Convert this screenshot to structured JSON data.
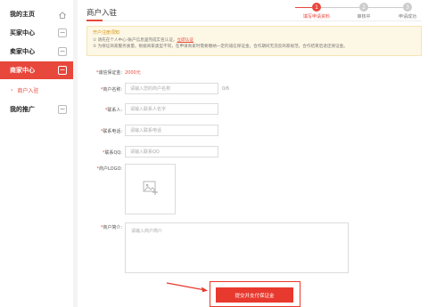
{
  "sidebar": {
    "items": [
      {
        "label": "我的主页",
        "icon": "home-icon"
      },
      {
        "label": "买家中心",
        "icon": "collapse-minus-icon"
      },
      {
        "label": "卖家中心",
        "icon": "collapse-minus-icon"
      },
      {
        "label": "商家中心",
        "icon": "collapse-minus-icon"
      },
      {
        "label": "我的推广",
        "icon": "collapse-minus-icon"
      }
    ],
    "sub_item": {
      "label": "商户入驻",
      "icon": "chevron-right-icon"
    }
  },
  "page": {
    "title": "商户入驻"
  },
  "steps": [
    {
      "num": "1",
      "label": "填写申请资料",
      "active": true
    },
    {
      "num": "2",
      "label": "审核中",
      "active": false
    },
    {
      "num": "3",
      "label": "申请成功",
      "active": false
    }
  ],
  "notice": {
    "title": "开户注册须知",
    "line1": "① 请先在个人中心-账户信息里完成实名认证，",
    "line1_link": "立即认证",
    "line2": "② 为保证商家服务质量，根据商家类型不同，在申请商家时需要缴纳一定的诚信保证金，合作期间无违反商家规范，合作结束后退还保证金。"
  },
  "form": {
    "fee_label": "诚信保证金:",
    "fee_value": "2000元",
    "name_label": "商户名称:",
    "name_placeholder": "请输入您的商户名称",
    "name_counter": "0/6",
    "contact_label": "联系人:",
    "contact_placeholder": "请输入联系人名字",
    "phone_label": "联系电话:",
    "phone_placeholder": "请输入联系电话",
    "qq_label": "联系QQ:",
    "qq_placeholder": "请输入联系QQ",
    "logo_label": "商户LOGO:",
    "logo_icon": "image-upload-icon",
    "intro_label": "商户简介:",
    "intro_placeholder": "请输入商户简介",
    "submit_label": "提交并支付保证金"
  },
  "colors": {
    "accent": "#e8473c",
    "notice_bg": "#fdf7e5",
    "step_inactive": "#cccccc"
  }
}
